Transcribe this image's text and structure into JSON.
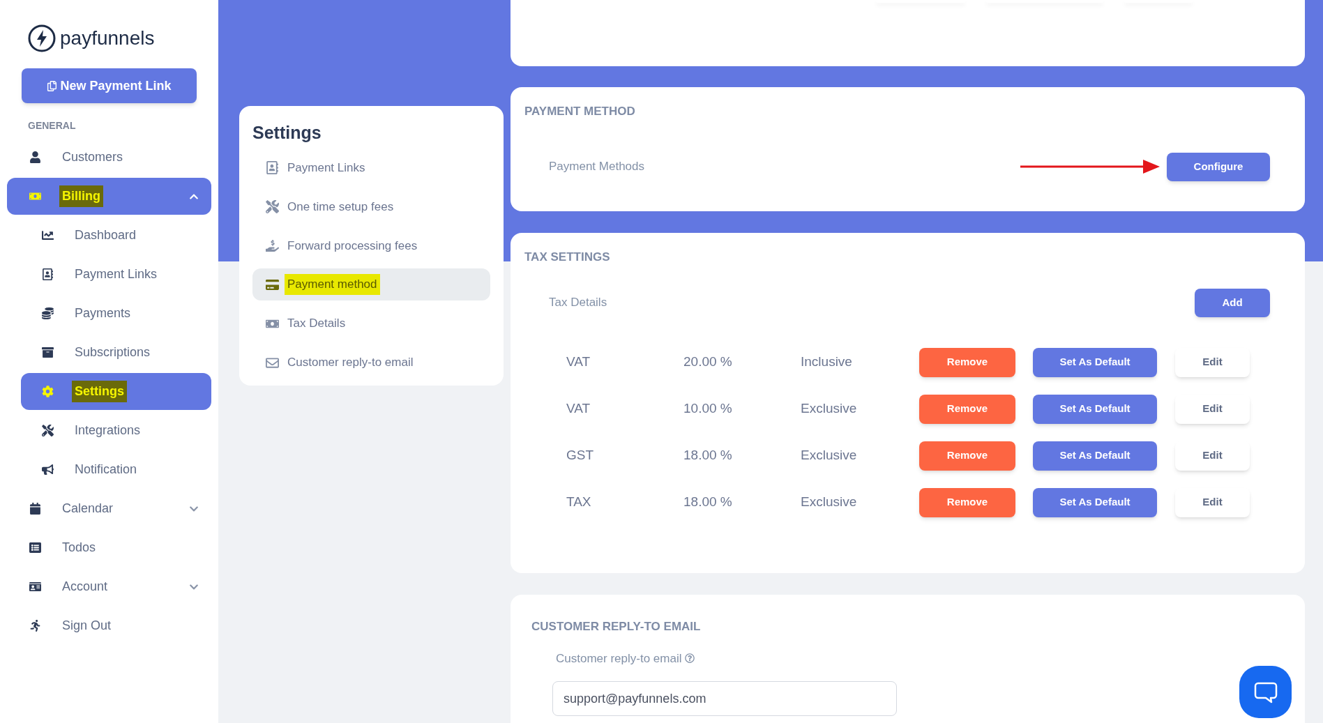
{
  "brand": {
    "name": "payfunnels"
  },
  "new_link_button": {
    "label": "New Payment Link"
  },
  "sidebar": {
    "section": "GENERAL",
    "items": [
      {
        "label": "Customers",
        "selected": false,
        "highlighted": false
      },
      {
        "label": "Billing",
        "selected": true,
        "highlighted": true,
        "expanded": true,
        "children": [
          {
            "label": "Dashboard",
            "selected": false,
            "highlighted": false
          },
          {
            "label": "Payment Links",
            "selected": false,
            "highlighted": false
          },
          {
            "label": "Payments",
            "selected": false,
            "highlighted": false
          },
          {
            "label": "Subscriptions",
            "selected": false,
            "highlighted": false
          },
          {
            "label": "Settings",
            "selected": true,
            "highlighted": true
          },
          {
            "label": "Integrations",
            "selected": false,
            "highlighted": false
          },
          {
            "label": "Notification",
            "selected": false,
            "highlighted": false
          }
        ]
      },
      {
        "label": "Calendar",
        "selected": false,
        "highlighted": false,
        "expanded": false
      },
      {
        "label": "Todos",
        "selected": false,
        "highlighted": false
      },
      {
        "label": "Account",
        "selected": false,
        "highlighted": false,
        "expanded": false
      },
      {
        "label": "Sign Out",
        "selected": false,
        "highlighted": false
      }
    ]
  },
  "settings_menu": {
    "title": "Settings",
    "items": [
      {
        "label": "Payment Links",
        "selected": false,
        "highlighted": false
      },
      {
        "label": "One time setup fees",
        "selected": false,
        "highlighted": false
      },
      {
        "label": "Forward processing fees",
        "selected": false,
        "highlighted": false
      },
      {
        "label": "Payment method",
        "selected": true,
        "highlighted": true
      },
      {
        "label": "Tax Details",
        "selected": false,
        "highlighted": false
      },
      {
        "label": "Customer reply-to email",
        "selected": false,
        "highlighted": false
      }
    ]
  },
  "payment_method": {
    "heading": "PAYMENT METHOD",
    "label": "Payment Methods",
    "button": "Configure"
  },
  "tax_settings": {
    "heading": "TAX SETTINGS",
    "label": "Tax Details",
    "add_button": "Add",
    "rows": [
      {
        "name": "VAT",
        "rate": "20.00 %",
        "type": "Inclusive",
        "buttons": {
          "remove": "Remove",
          "default": "Set As Default",
          "edit": "Edit"
        }
      },
      {
        "name": "VAT",
        "rate": "10.00 %",
        "type": "Exclusive",
        "buttons": {
          "remove": "Remove",
          "default": "Set As Default",
          "edit": "Edit"
        }
      },
      {
        "name": "GST",
        "rate": "18.00 %",
        "type": "Exclusive",
        "buttons": {
          "remove": "Remove",
          "default": "Set As Default",
          "edit": "Edit"
        }
      },
      {
        "name": "TAX",
        "rate": "18.00 %",
        "type": "Exclusive",
        "buttons": {
          "remove": "Remove",
          "default": "Set As Default",
          "edit": "Edit"
        }
      }
    ]
  },
  "reply_to": {
    "heading": "CUSTOMER REPLY-TO EMAIL",
    "label": "Customer reply-to email",
    "value": "support@payfunnels.com"
  }
}
